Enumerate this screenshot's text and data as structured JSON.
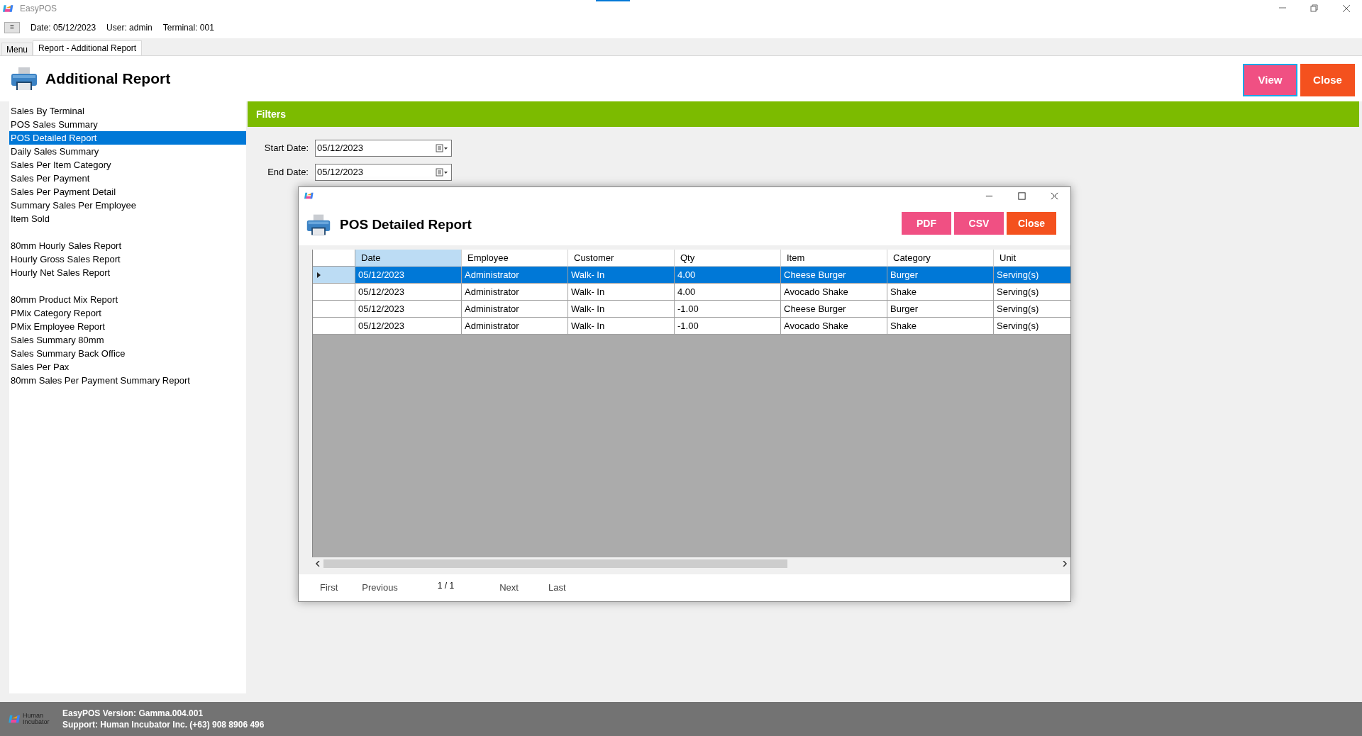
{
  "window": {
    "title": "EasyPOS"
  },
  "info_bar": {
    "menu_button": "=",
    "date": "Date: 05/12/2023",
    "user": "User: admin",
    "terminal": "Terminal: 001"
  },
  "tabs": [
    {
      "label": "Menu",
      "selected": false
    },
    {
      "label": "Report - Additional Report",
      "selected": true
    }
  ],
  "header": {
    "title": "Additional Report",
    "buttons": [
      "View",
      "Close"
    ]
  },
  "sidebar": {
    "groups": [
      {
        "items": [
          {
            "label": "Sales By Terminal",
            "selected": false
          },
          {
            "label": "POS Sales Summary",
            "selected": false
          },
          {
            "label": "POS Detailed Report",
            "selected": true
          },
          {
            "label": "Daily Sales Summary",
            "selected": false
          },
          {
            "label": "Sales Per Item Category",
            "selected": false
          },
          {
            "label": "Sales Per Payment",
            "selected": false
          },
          {
            "label": "Sales Per Payment Detail",
            "selected": false
          },
          {
            "label": "Summary Sales Per Employee",
            "selected": false
          },
          {
            "label": "Item Sold",
            "selected": false
          }
        ]
      },
      {
        "items": [
          {
            "label": "80mm Hourly Sales Report",
            "selected": false
          },
          {
            "label": "Hourly Gross Sales Report",
            "selected": false
          },
          {
            "label": "Hourly Net Sales Report",
            "selected": false
          }
        ]
      },
      {
        "items": [
          {
            "label": "80mm Product Mix Report",
            "selected": false
          },
          {
            "label": "PMix Category Report",
            "selected": false
          },
          {
            "label": "PMix Employee Report",
            "selected": false
          },
          {
            "label": "Sales Summary 80mm",
            "selected": false
          },
          {
            "label": "Sales Summary Back Office",
            "selected": false
          },
          {
            "label": "Sales Per Pax",
            "selected": false
          },
          {
            "label": "80mm Sales Per Payment Summary Report",
            "selected": false
          }
        ]
      }
    ]
  },
  "filters": {
    "title": "Filters",
    "fields": [
      {
        "label": "Start Date:",
        "value": "05/12/2023"
      },
      {
        "label": "End Date:",
        "value": "05/12/2023"
      }
    ]
  },
  "dialog": {
    "title": "POS Detailed Report",
    "buttons": [
      "PDF",
      "CSV",
      "Close"
    ],
    "table": {
      "columns": [
        {
          "label": "Date",
          "selected": true
        },
        {
          "label": "Employee",
          "selected": false
        },
        {
          "label": "Customer",
          "selected": false
        },
        {
          "label": "Qty",
          "selected": false
        },
        {
          "label": "Item",
          "selected": false
        },
        {
          "label": "Category",
          "selected": false
        },
        {
          "label": "Unit",
          "selected": false
        }
      ],
      "rows": [
        {
          "selected": true,
          "cells": [
            "05/12/2023",
            "Administrator",
            "Walk- In",
            "4.00",
            "Cheese Burger",
            "Burger",
            "Serving(s)"
          ]
        },
        {
          "selected": false,
          "cells": [
            "05/12/2023",
            "Administrator",
            "Walk- In",
            "4.00",
            "Avocado Shake",
            "Shake",
            "Serving(s)"
          ]
        },
        {
          "selected": false,
          "cells": [
            "05/12/2023",
            "Administrator",
            "Walk- In",
            "-1.00",
            "Cheese Burger",
            "Burger",
            "Serving(s)"
          ]
        },
        {
          "selected": false,
          "cells": [
            "05/12/2023",
            "Administrator",
            "Walk- In",
            "-1.00",
            "Avocado Shake",
            "Shake",
            "Serving(s)"
          ]
        }
      ]
    },
    "pager": {
      "first": "First",
      "previous": "Previous",
      "page": "1 / 1",
      "next": "Next",
      "last": "Last"
    }
  },
  "status_bar": {
    "logo_text": "Human Incubator",
    "version": "EasyPOS Version: Gamma.004.001",
    "support": "Support: Human Incubator Inc. (+63) 908 8906 496"
  }
}
